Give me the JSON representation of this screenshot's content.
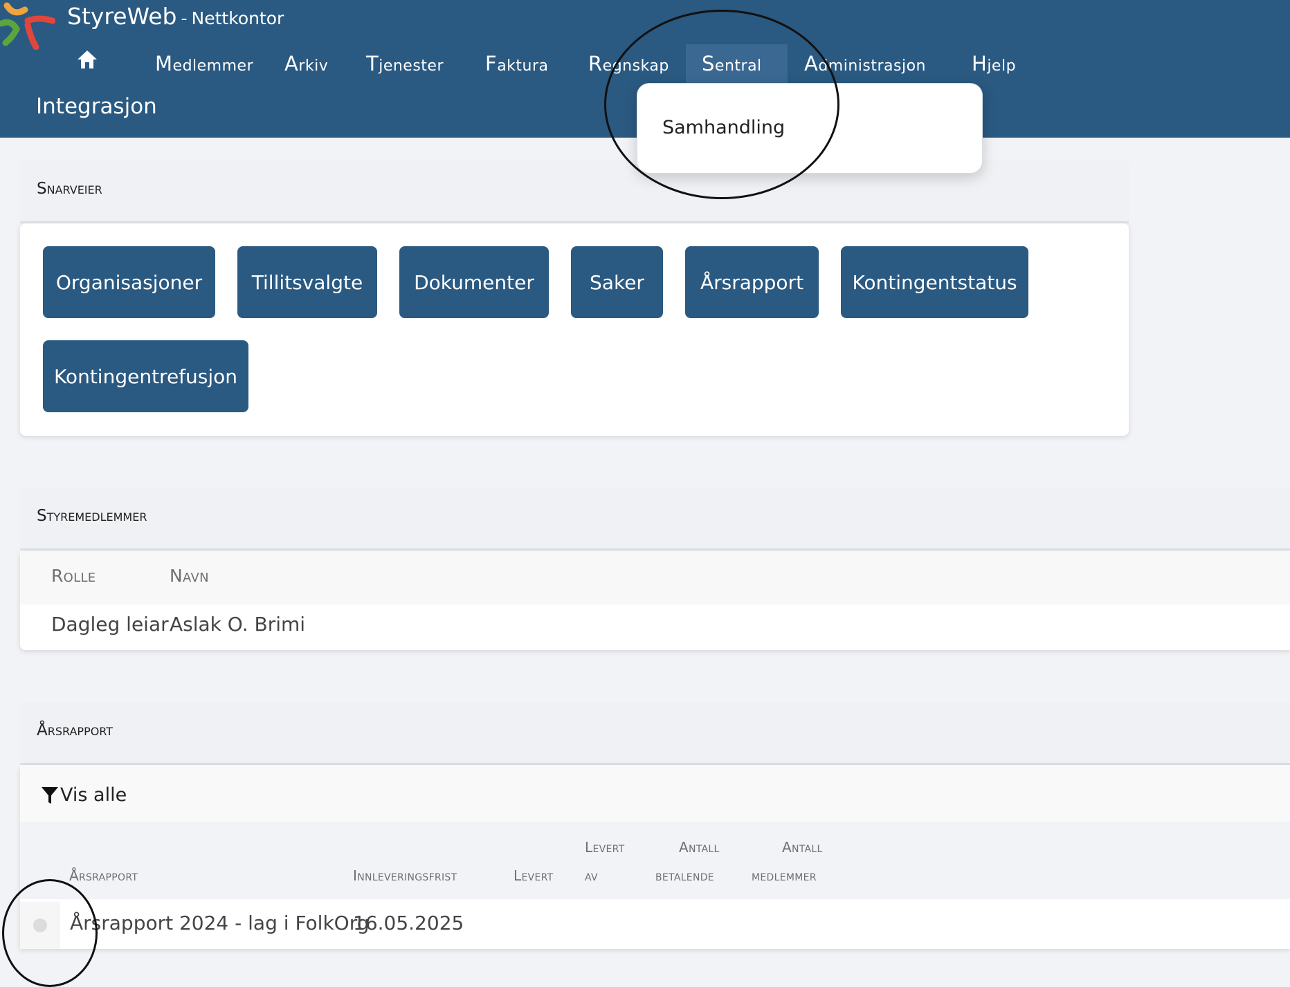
{
  "app": {
    "name": "StyreWeb",
    "separator": "-",
    "subtitle": "Nettkontor"
  },
  "nav": {
    "home_icon": "home-icon",
    "items": [
      "Medlemmer",
      "Arkiv",
      "Tjenester",
      "Faktura",
      "Regnskap",
      "Sentral",
      "Administrasjon",
      "Hjelp"
    ],
    "active": "Sentral"
  },
  "page_title": "Integrasjon",
  "dropdown": {
    "items": [
      "Samhandling"
    ]
  },
  "shortcuts": {
    "title": "Snarveier",
    "buttons": [
      "Organisasjoner",
      "Tillitsvalgte",
      "Dokumenter",
      "Saker",
      "Årsrapport",
      "Kontingentstatus",
      "Kontingentrefusjon"
    ]
  },
  "board": {
    "title": "Styremedlemmer",
    "columns": [
      "Rolle",
      "Navn"
    ],
    "rows": [
      {
        "rolle": "Dagleg leiar",
        "navn": "Aslak O. Brimi"
      }
    ]
  },
  "annual": {
    "title": "Årsrapport",
    "filter_icon": "filter-icon",
    "filter_label": "Vis alle",
    "columns": {
      "arsrapport": "Årsrapport",
      "frist": "Innleveringsfrist",
      "levert": "Levert",
      "levert_av_1": "Levert",
      "levert_av_2": "av",
      "betalende_1": "Antall",
      "betalende_2": "betalende",
      "medlemmer_1": "Antall",
      "medlemmer_2": "medlemmer"
    },
    "rows": [
      {
        "arsrapport": "Årsrapport 2024 - lag i FolkOrg",
        "frist": "16.05.2025"
      }
    ]
  },
  "colors": {
    "header": "#2a5981",
    "button": "#2a5981",
    "active_nav": "#3a6892"
  }
}
